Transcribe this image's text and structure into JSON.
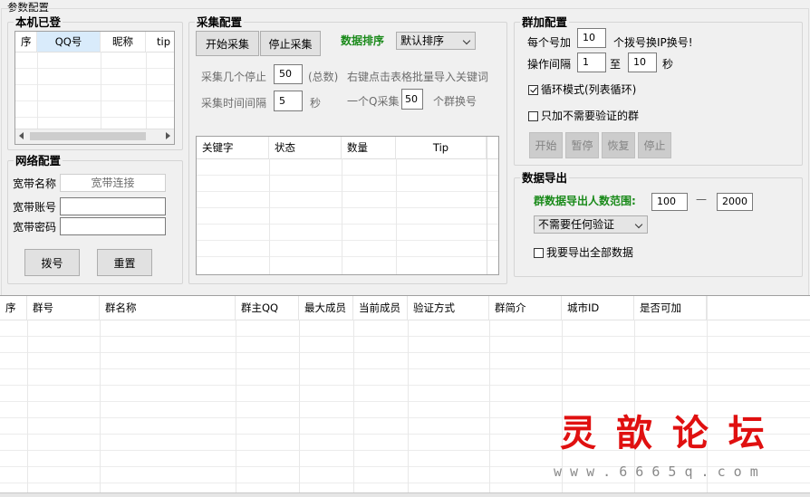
{
  "window": {
    "title": "参数配置"
  },
  "local": {
    "title": "本机已登",
    "columns": [
      "序",
      "QQ号",
      "昵称",
      "tip"
    ]
  },
  "network": {
    "title": "网络配置",
    "name_label": "宽带名称",
    "name_placeholder": "宽带连接",
    "account_label": "宽带账号",
    "password_label": "宽带密码",
    "dial_button": "拨号",
    "reset_button": "重置"
  },
  "collect": {
    "title": "采集配置",
    "start_button": "开始采集",
    "stop_button": "停止采集",
    "sort_label": "数据排序",
    "sort_value": "默认排序",
    "stop_after_label": "采集几个停止",
    "stop_after_value": "50",
    "total_label": "(总数)",
    "hint": "右键点击表格批量导入关键词",
    "interval_label": "采集时间间隔",
    "interval_value": "5",
    "seconds": "秒",
    "per_q_label": "一个Q采集",
    "per_q_value": "50",
    "per_q_suffix": "个群换号",
    "columns": [
      "关键字",
      "状态",
      "数量",
      "Tip"
    ]
  },
  "join": {
    "title": "群加配置",
    "per_num_label": "每个号加",
    "per_num_value": "10",
    "per_num_suffix": "个拨号换IP换号!",
    "interval_label": "操作间隔",
    "interval_from": "1",
    "to_label": "至",
    "interval_to": "10",
    "seconds": "秒",
    "loop_label": "循环模式(列表循环)",
    "loop_checked": true,
    "no_verify_label": "只加不需要验证的群",
    "no_verify_checked": false,
    "start_button": "开始",
    "pause_button": "暂停",
    "resume_button": "恢复",
    "stop_button": "停止"
  },
  "export": {
    "title": "数据导出",
    "range_label": "群数据导出人数范围:",
    "range_from": "100",
    "range_dash": "—",
    "range_to": "2000",
    "verify_value": "不需要任何验证",
    "export_all_label": "我要导出全部数据",
    "export_all_checked": false
  },
  "results": {
    "columns": [
      "序",
      "群号",
      "群名称",
      "群主QQ",
      "最大成员",
      "当前成员",
      "验证方式",
      "群简介",
      "城市ID",
      "是否可加"
    ]
  },
  "watermark": {
    "logo": "灵 歆 论 坛",
    "url": "w w w . 6 6 6 5 q . c o m"
  }
}
